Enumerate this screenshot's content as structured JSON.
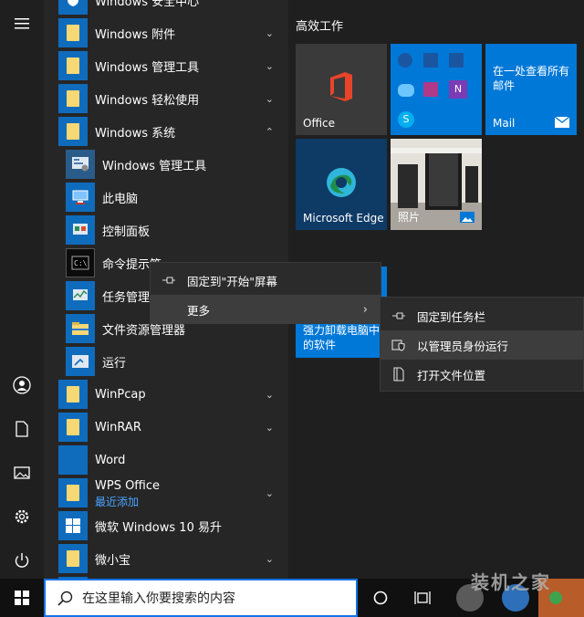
{
  "rail": {
    "icons": [
      "hamburger-menu-icon",
      "user-avatar-icon",
      "document-icon",
      "pictures-icon",
      "settings-gear-icon",
      "power-icon"
    ]
  },
  "applist": {
    "items": [
      {
        "label": "Windows 安全中心",
        "kind": "shield"
      },
      {
        "label": "Windows 附件",
        "kind": "folder",
        "expand": "v"
      },
      {
        "label": "Windows 管理工具",
        "kind": "folder",
        "expand": "v"
      },
      {
        "label": "Windows 轻松使用",
        "kind": "folder",
        "expand": "v"
      },
      {
        "label": "Windows 系统",
        "kind": "folder",
        "expand": "^"
      },
      {
        "label": "Windows 管理工具",
        "kind": "sub"
      },
      {
        "label": "此电脑",
        "kind": "sub"
      },
      {
        "label": "控制面板",
        "kind": "sub"
      },
      {
        "label": "命令提示符",
        "kind": "sub"
      },
      {
        "label": "任务管理器",
        "kind": "sub"
      },
      {
        "label": "文件资源管理器",
        "kind": "sub"
      },
      {
        "label": "运行",
        "kind": "sub"
      },
      {
        "label": "WinPcap",
        "kind": "folder",
        "expand": "v"
      },
      {
        "label": "WinRAR",
        "kind": "folder",
        "expand": "v"
      },
      {
        "label": "Word",
        "kind": "word"
      },
      {
        "label": "WPS Office",
        "kind": "folder",
        "expand": "v",
        "sublabel": "最近添加"
      },
      {
        "label": "微软 Windows 10 易升",
        "kind": "win"
      },
      {
        "label": "微小宝",
        "kind": "folder",
        "expand": "v"
      }
    ]
  },
  "tiles": {
    "group_title": "高效工作",
    "office": "Office",
    "mail_text": "在一处查看所有邮件",
    "mail": "Mail",
    "edge": "Microsoft Edge",
    "photos": "照片",
    "partial": "强力卸载电脑中的软件"
  },
  "context_menu": {
    "items": [
      "固定到\"开始\"屏幕",
      "更多"
    ]
  },
  "submenu": {
    "items": [
      "固定到任务栏",
      "以管理员身份运行",
      "打开文件位置"
    ]
  },
  "taskbar": {
    "search_placeholder": "在这里输入你要搜索的内容",
    "watermark": "装机之家"
  },
  "colors": {
    "accent": "#0078d7",
    "tile_blue": "#0078d7",
    "menu_bg": "#2b2b2b",
    "menu_hover": "#3d3d3d"
  }
}
